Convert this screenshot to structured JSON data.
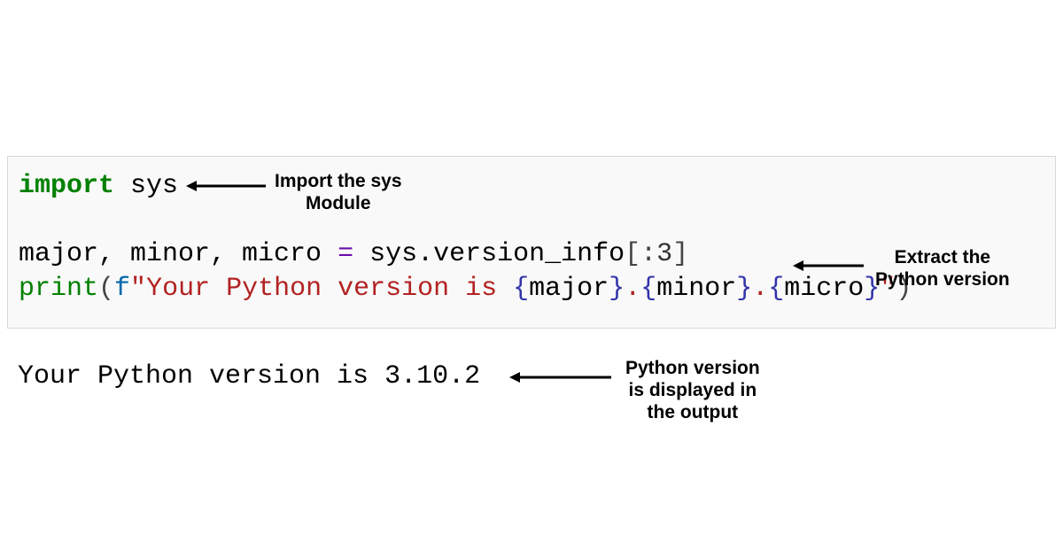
{
  "code": {
    "line1": {
      "keyword": "import",
      "module": "sys"
    },
    "line2": {
      "vars": "major, minor, micro ",
      "eq": "=",
      "rhs_name": " sys",
      "rhs_attr": ".version_info",
      "lbracket": "[",
      "colon": ":",
      "num": "3",
      "rbracket": "]"
    },
    "line3": {
      "builtin": "print",
      "lparen": "(",
      "fprefix": "f",
      "str_open": "\"",
      "str1": "Your Python version is ",
      "lb1": "{",
      "v1": "major",
      "rb1": "}",
      "dot1": ".",
      "lb2": "{",
      "v2": "minor",
      "rb2": "}",
      "dot2": ".",
      "lb3": "{",
      "v3": "micro",
      "rb3": "}",
      "str_close": "\"",
      "rparen": ")"
    }
  },
  "output": "Your Python version is 3.10.2",
  "annotations": {
    "a1_line1": "Import the sys",
    "a1_line2": "Module",
    "a2_line1": "Extract the",
    "a2_line2": "Python version",
    "a3_line1": "Python version",
    "a3_line2": "is displayed in",
    "a3_line3": "the output"
  }
}
